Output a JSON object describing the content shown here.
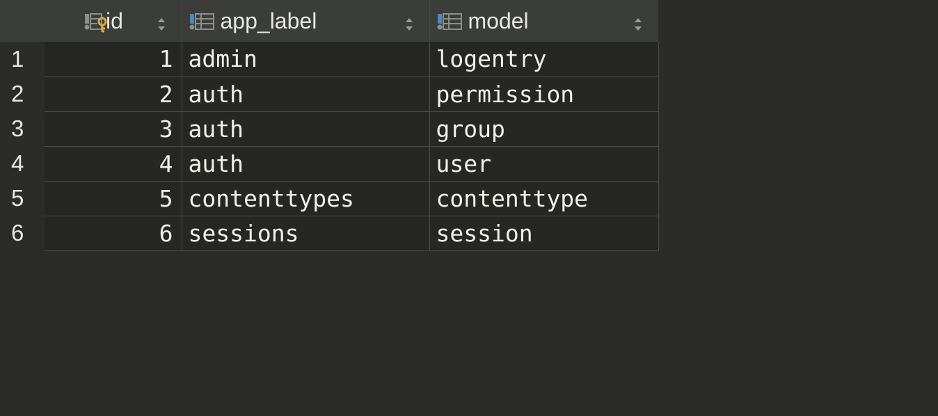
{
  "table": {
    "columns": [
      {
        "name": "id",
        "icon": "primary-key-column-icon"
      },
      {
        "name": "app_label",
        "icon": "column-icon"
      },
      {
        "name": "model",
        "icon": "column-icon"
      }
    ],
    "rows": [
      {
        "row_number": "1",
        "id": "1",
        "app_label": "admin",
        "model": "logentry"
      },
      {
        "row_number": "2",
        "id": "2",
        "app_label": "auth",
        "model": "permission"
      },
      {
        "row_number": "3",
        "id": "3",
        "app_label": "auth",
        "model": "group"
      },
      {
        "row_number": "4",
        "id": "4",
        "app_label": "auth",
        "model": "user"
      },
      {
        "row_number": "5",
        "id": "5",
        "app_label": "contenttypes",
        "model": "contenttype"
      },
      {
        "row_number": "6",
        "id": "6",
        "app_label": "sessions",
        "model": "session"
      }
    ]
  },
  "colors": {
    "background": "#2b2c27",
    "header_background": "#3b3d38",
    "cell_background": "#262722",
    "grid_line": "#4a4c46",
    "text": "#f0f0ea",
    "key_icon": "#e0a93b",
    "column_icon_accent": "#4a86c8"
  }
}
